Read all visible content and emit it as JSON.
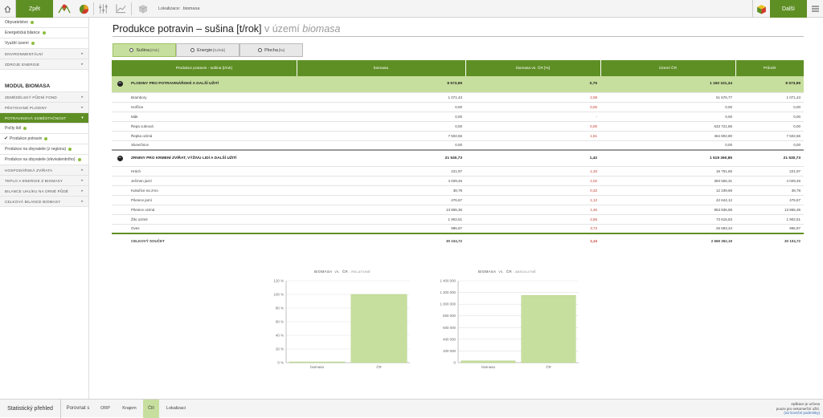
{
  "topbar": {
    "back_label": "Zpět",
    "location_label": "Lokalizace:",
    "location_value": "biomasa",
    "next_label": "Další"
  },
  "sidebar": {
    "items_top": [
      {
        "label": "Obyvatelstvo",
        "dot": true
      },
      {
        "label": "Energetická bilance",
        "dot": true
      },
      {
        "label": "Využití území",
        "dot": true
      }
    ],
    "cats_top": [
      "ENVIRONMENTÁLNÍ",
      "ZDROJE ENERGIE"
    ],
    "module_title": "MODUL BIOMASA",
    "cats_mod": [
      "ZEMĚDĚLSKÝ PŮDNÍ FOND",
      "PĚSTOVANÉ PLODINY"
    ],
    "active_cat": "POTRAVINOVÁ SOBĚSTAČNOST",
    "sub_items": [
      {
        "label": "Počty lidí",
        "dot": true,
        "checked": false
      },
      {
        "label": "Produkce potravin",
        "dot": true,
        "checked": true
      },
      {
        "label": "Produkce na obyvatele (z regionu)",
        "dot": true,
        "checked": false
      },
      {
        "label": "Produkce na obyvatele (ekvivalentního)",
        "dot": true,
        "checked": false
      }
    ],
    "cats_bottom": [
      "HOSPODÁŘSKÁ ZVÍŘATA",
      "TEPLO A ENERGIE Z BIOMASY",
      "BILANCE UHLÍKU NA ORNÉ PŮDĚ",
      "CELKOVÁ BILANCE BIOMASY"
    ]
  },
  "page": {
    "title_main": "Produkce potravin – sušina [t/rok]",
    "title_in": "v území",
    "title_place": "biomasa"
  },
  "tabs": [
    {
      "label": "Sušina",
      "unit": "[t/rok]",
      "selected": true
    },
    {
      "label": "Energie",
      "unit": "[GJ/rok]",
      "selected": false
    },
    {
      "label": "Plocha",
      "unit": "[ha]",
      "selected": false
    }
  ],
  "table": {
    "headers": [
      "Produkce potravin - sušina [t/rok]",
      "biomasa",
      "biomasa vs. ČR [%]",
      "Území ČR",
      "Průměr"
    ],
    "groups": [
      {
        "name": "PLODINY PRO POTRAVINÁŘSKÉ A DALŠÍ UŽITÍ",
        "values": [
          "8 573,99",
          "0,75",
          "1 150 101,34",
          "8 573,99"
        ],
        "rows": [
          [
            "Brambory",
            "1 071,43",
            "2,08",
            "51 576,77",
            "1 071,43"
          ],
          [
            "Hořčice",
            "0,00",
            "0,00",
            "0,00",
            "0,00"
          ],
          [
            "Mák",
            "0,00",
            "-",
            "0,00",
            "0,00"
          ],
          [
            "Řepa cukrová",
            "0,00",
            "0,00",
            "633 721,86",
            "0,00"
          ],
          [
            "Řepka ozimá",
            "7 502,56",
            "1,61",
            "464 802,80",
            "7 502,56"
          ],
          [
            "Slunečnice",
            "0,00",
            "",
            "0,00",
            "0,00"
          ]
        ]
      },
      {
        "name": "ZRNINY PRO KRMENÍ ZVÍŘAT, VÝŽIVU LIDÍ A DALŠÍ UŽITÍ",
        "values": [
          "21 530,73",
          "1,42",
          "1 519 260,85",
          "21 530,73"
        ],
        "rows": [
          [
            "Hrách",
            "221,97",
            "1,33",
            "16 751,65",
            "221,97"
          ],
          [
            "Ječmen jarní",
            "4 029,46",
            "1,02",
            "393 556,31",
            "4 029,46"
          ],
          [
            "Kukuřice na zrno",
            "38,78",
            "0,32",
            "12 239,69",
            "38,78"
          ],
          [
            "Pšenice jarní",
            "476,67",
            "1,12",
            "42 644,12",
            "476,67"
          ],
          [
            "Pšenice ozimá",
            "13 865,36",
            "1,46",
            "953 836,88",
            "13 865,36"
          ],
          [
            "Žito ozimé",
            "1 902,51",
            "2,56",
            "73 615,83",
            "1 902,51"
          ],
          [
            "Oves",
            "995,97",
            "3,73",
            "26 693,34",
            "995,97"
          ]
        ]
      }
    ],
    "total": [
      "CELKOVÝ SOUČET",
      "30 104,72",
      "1,13",
      "2 669 362,19",
      "30 104,72"
    ]
  },
  "chart_data": [
    {
      "type": "bar",
      "title": "BIOMASA",
      "title_vs": "vs.",
      "title_cr": "ČR",
      "title_suffix": "- RELATIVNĚ",
      "categories": [
        "biomasa",
        "ČR"
      ],
      "values": [
        1.13,
        100
      ],
      "ylim": [
        0,
        120
      ],
      "yticks": [
        "0 %",
        "20 %",
        "40 %",
        "60 %",
        "80 %",
        "100 %",
        "120 %"
      ],
      "bar_color": "#c7df9e",
      "grid": true
    },
    {
      "type": "bar",
      "title": "BIOMASA",
      "title_vs": "vs.",
      "title_cr": "ČR",
      "title_suffix": "- ABSOLUTNĚ",
      "categories": [
        "biomasa",
        "ČR"
      ],
      "values": [
        30104.72,
        1150101.34
      ],
      "ylim": [
        0,
        1400000
      ],
      "yticks": [
        "0",
        "200 000",
        "400 000",
        "600 000",
        "800 000",
        "1 000 000",
        "1 200 000",
        "1 400 000"
      ],
      "bar_color": "#c7df9e",
      "grid": true
    }
  ],
  "bottombar": {
    "stat_label": "Statistický přehled",
    "compare_label": "Porovnat s",
    "items": [
      "ORP",
      "Krajem",
      "ČR",
      "Lokalizaci"
    ],
    "active_item": "ČR",
    "note_line1": "Aplikace je určena",
    "note_line2": "pouze pro nekomerční užití.",
    "note_link": "(viz licenční podmínky)"
  },
  "colors": {
    "accent": "#5e8f24",
    "light_accent": "#c7df9e",
    "negative": "#c0392b"
  }
}
